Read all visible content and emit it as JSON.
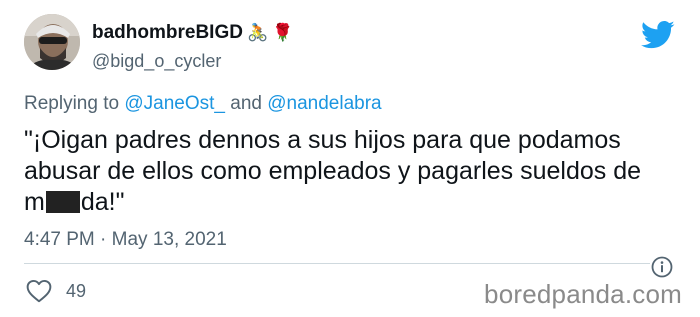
{
  "user": {
    "display_name": "badhombreBIGD",
    "name_emojis": [
      "🚴",
      "🌹"
    ],
    "handle": "@bigd_o_cycler",
    "avatar_icon": "avatar-photo-icon"
  },
  "reply": {
    "prefix": "Replying to",
    "mention_1": "@JaneOst_",
    "joiner": "and",
    "mention_2": "@nandelabra"
  },
  "tweet": {
    "line_1": "\"¡Oigan padres dennos a sus hijos para que podamos",
    "line_2": "abusar de ellos como empleados y pagarles sueldos de",
    "line_3_start": "m",
    "line_3_end": "da!\""
  },
  "meta": {
    "time": "4:47 PM",
    "separator": "·",
    "date": "May 13, 2021"
  },
  "actions": {
    "like_count": "49"
  },
  "watermark": "boredpanda.com",
  "colors": {
    "text": "#0f1419",
    "secondary": "#536471",
    "mention": "#1b95e0",
    "twitter_blue": "#1da1f2",
    "watermark": "#8a8a8a"
  },
  "icons": {
    "brand": "twitter-bird-icon",
    "info": "info-icon",
    "like": "heart-outline-icon"
  }
}
